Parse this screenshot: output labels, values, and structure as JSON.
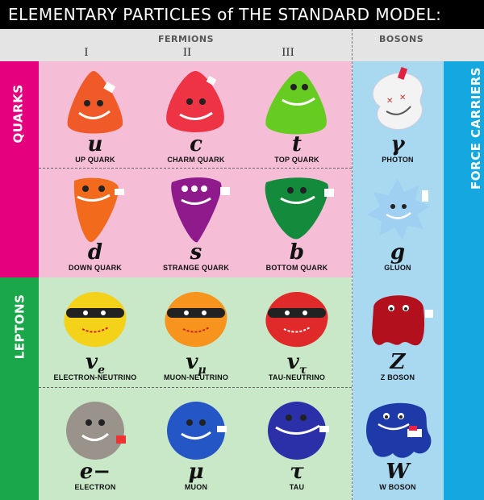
{
  "title": "ELEMENTARY PARTICLES of THE STANDARD MODEL:",
  "headers": {
    "fermions": "FERMIONS",
    "bosons": "BOSONS"
  },
  "generations": [
    "I",
    "II",
    "III"
  ],
  "side_labels": {
    "quarks": "QUARKS",
    "leptons": "LEPTONS",
    "force_carriers": "FORCE CARRIERS"
  },
  "colors": {
    "quarks_band": "#e5007e",
    "leptons_band": "#19a74a",
    "force_band": "#14a7e0",
    "quarks_panel": "#f5bed6",
    "leptons_panel": "#c9e8c8",
    "bosons_panel": "#a9d8f1"
  },
  "quarks": [
    {
      "symbol": "u",
      "name": "UP QUARK",
      "plush_color": "#f05a28"
    },
    {
      "symbol": "c",
      "name": "CHARM QUARK",
      "plush_color": "#ee3344"
    },
    {
      "symbol": "t",
      "name": "TOP QUARK",
      "plush_color": "#66cc22"
    },
    {
      "symbol": "d",
      "name": "DOWN QUARK",
      "plush_color": "#f26a1b"
    },
    {
      "symbol": "s",
      "name": "STRANGE QUARK",
      "plush_color": "#8e1a8c"
    },
    {
      "symbol": "b",
      "name": "BOTTOM QUARK",
      "plush_color": "#138a3c"
    }
  ],
  "leptons": [
    {
      "symbol": "v",
      "sub": "e",
      "name": "ELECTRON-NEUTRINO",
      "plush_color": "#f5d21a"
    },
    {
      "symbol": "v",
      "sub": "μ",
      "name": "MUON-NEUTRINO",
      "plush_color": "#f7941d"
    },
    {
      "symbol": "v",
      "sub": "τ",
      "name": "TAU-NEUTRINO",
      "plush_color": "#e02a2a"
    },
    {
      "symbol": "e−",
      "name": "ELECTRON",
      "plush_color": "#9a938c"
    },
    {
      "symbol": "μ",
      "name": "MUON",
      "plush_color": "#2457c5"
    },
    {
      "symbol": "τ",
      "name": "TAU",
      "plush_color": "#2b2fa8"
    }
  ],
  "bosons": [
    {
      "symbol": "γ",
      "name": "PHOTON",
      "plush_color": "#f3f3f3"
    },
    {
      "symbol": "g",
      "name": "GLUON",
      "plush_color": "#9fd0f2"
    },
    {
      "symbol": "Z",
      "name": "Z BOSON",
      "plush_color": "#b3101e"
    },
    {
      "symbol": "W",
      "name": "W BOSON",
      "plush_color": "#1e3aa8"
    }
  ]
}
